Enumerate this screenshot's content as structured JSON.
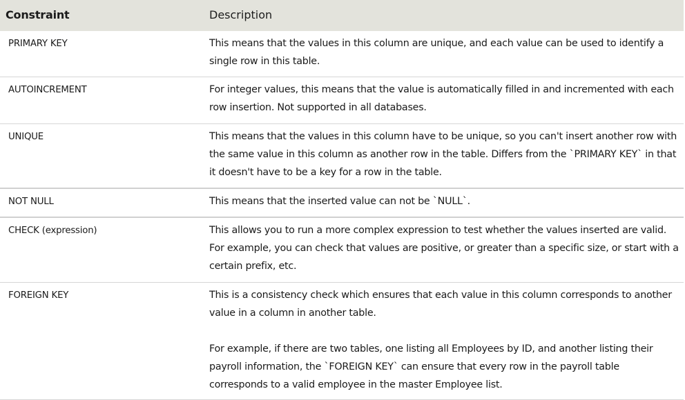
{
  "table": {
    "headers": {
      "constraint": "Constraint",
      "description": "Description"
    },
    "rows": [
      {
        "constraint": "PRIMARY KEY",
        "description": [
          "This means that the values in this column are unique, and each value can be used to identify a single row in this table."
        ]
      },
      {
        "constraint": "AUTOINCREMENT",
        "description": [
          "For integer values, this means that the value is automatically filled in and incremented with each row insertion. Not supported in all databases."
        ]
      },
      {
        "constraint": "UNIQUE",
        "description": [
          "This means that the values in this column have to be unique, so you can't insert another row with the same value in this column as another row in the table. Differs from the `PRIMARY KEY` in that it doesn't have to be a key for a row in the table."
        ]
      },
      {
        "constraint": "NOT NULL",
        "description": [
          "This means that the inserted value can not be `NULL`."
        ]
      },
      {
        "constraint": "CHECK (expression)",
        "description": [
          "This allows you to run a more complex expression to test whether the values inserted are valid. For example, you can check that values are positive, or greater than a specific size, or start with a certain prefix, etc."
        ]
      },
      {
        "constraint": "FOREIGN KEY",
        "description": [
          "This is a consistency check which ensures that each value in this column corresponds to another value in a column in another table.",
          "For example, if there are two tables, one listing all Employees by ID, and another listing their payroll information, the `FOREIGN KEY` can ensure that every row in the payroll table corresponds to a valid employee in the master Employee list."
        ]
      }
    ]
  }
}
